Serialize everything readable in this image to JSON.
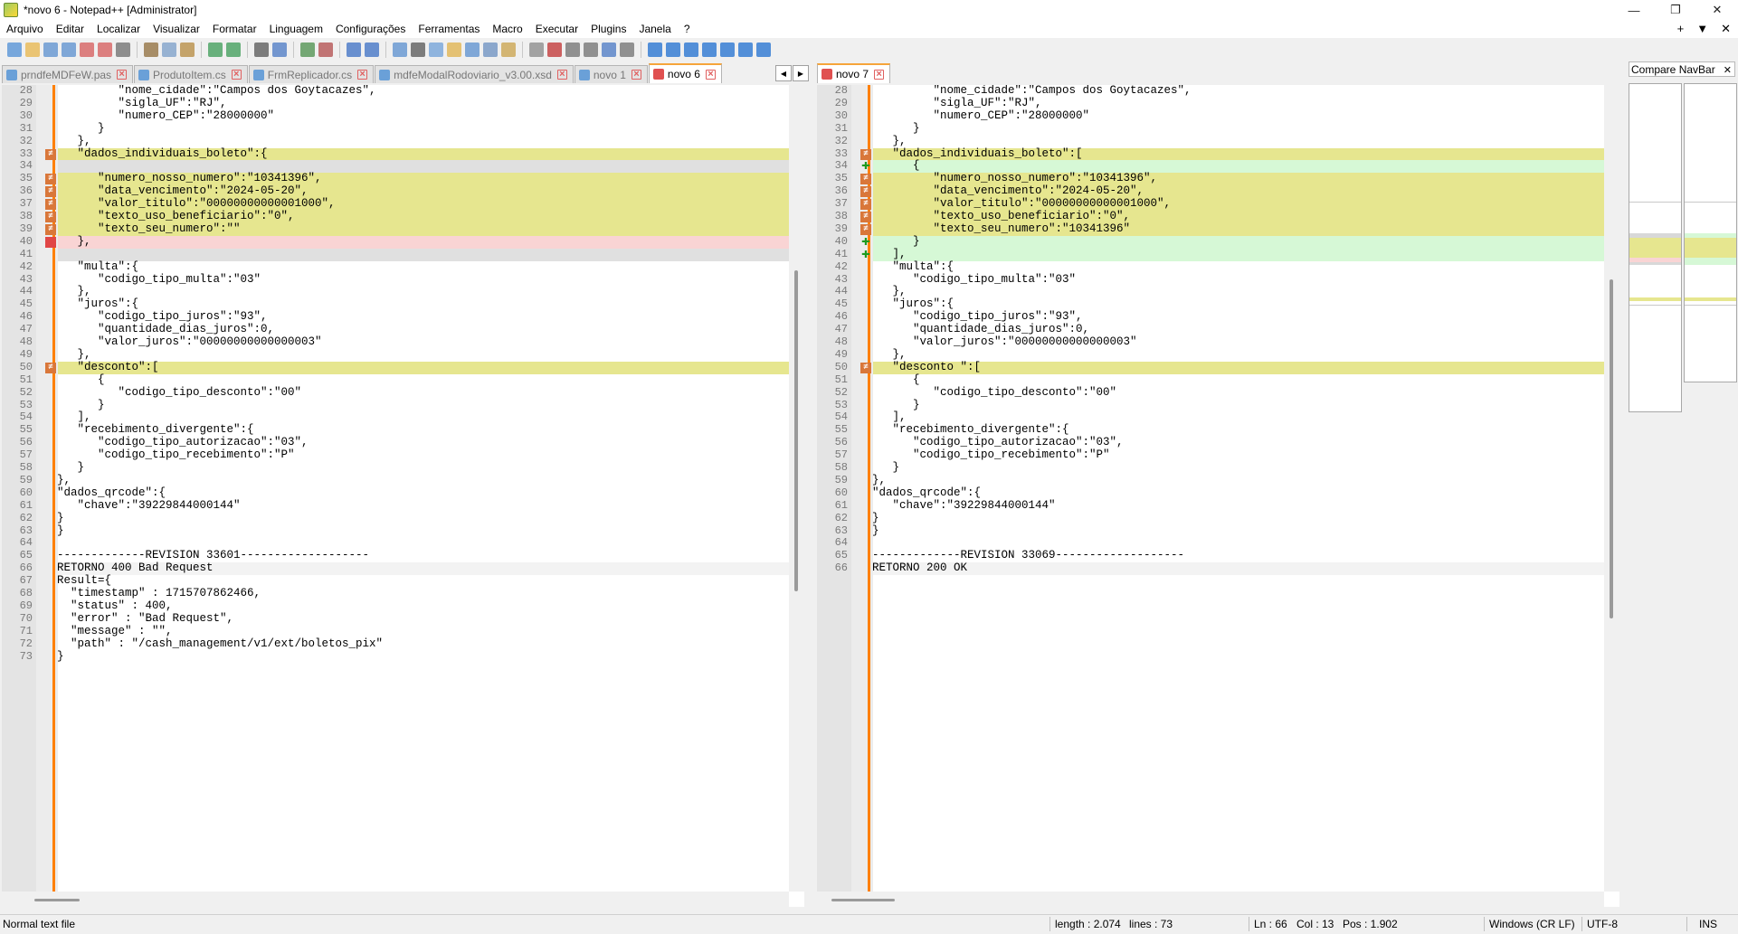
{
  "window": {
    "title": "*novo 6 - Notepad++ [Administrator]",
    "controls": [
      "—",
      "❐",
      "✕"
    ]
  },
  "menu": {
    "items": [
      "Arquivo",
      "Editar",
      "Localizar",
      "Visualizar",
      "Formatar",
      "Linguagem",
      "Configurações",
      "Ferramentas",
      "Macro",
      "Executar",
      "Plugins",
      "Janela",
      "?"
    ],
    "right": [
      "+",
      "▼",
      "✕"
    ]
  },
  "toolbar": {
    "icons": [
      "new-file-icon",
      "open-icon",
      "save-icon",
      "save-all-icon",
      "close-icon",
      "close-all-icon",
      "print-icon",
      "cut-icon",
      "copy-icon",
      "paste-icon",
      "undo-icon",
      "redo-icon",
      "find-icon",
      "replace-icon",
      "zoom-in-icon",
      "zoom-out-icon",
      "sync-vertical-icon",
      "sync-horizontal-icon",
      "word-wrap-icon",
      "show-all-chars-icon",
      "indent-guide-icon",
      "udl-icon",
      "doc-map-icon",
      "function-list-icon",
      "folder-workspace-icon",
      "monitoring-icon",
      "record-macro-icon",
      "stop-macro-icon",
      "play-macro-icon",
      "run-macro-multiple-icon",
      "save-macro-icon",
      "compare-icon",
      "compare-clear-icon",
      "compare-first-icon",
      "compare-prev-icon",
      "compare-next-icon",
      "compare-last-icon",
      "compare-navbar-icon"
    ]
  },
  "tabs_left": [
    {
      "label": "prndfeMDFeW.pas",
      "color": "#6aa0d8",
      "active": false
    },
    {
      "label": "ProdutoItem.cs",
      "color": "#6aa0d8",
      "active": false
    },
    {
      "label": "FrmReplicador.cs",
      "color": "#6aa0d8",
      "active": false
    },
    {
      "label": "mdfeModalRodoviario_v3.00.xsd",
      "color": "#6aa0d8",
      "active": false
    },
    {
      "label": "novo 1",
      "color": "#6aa0d8",
      "active": false
    },
    {
      "label": "novo 6",
      "color": "#e05050",
      "active": true
    }
  ],
  "tabs_right": [
    {
      "label": "novo 7",
      "color": "#e05050",
      "active": true
    }
  ],
  "tab_nav": [
    "◀",
    "▶"
  ],
  "left_lines": [
    {
      "n": "28",
      "t": "         \"nome_cidade\":\"Campos dos Goytacazes\",",
      "bg": "",
      "mark": ""
    },
    {
      "n": "29",
      "t": "         \"sigla_UF\":\"RJ\",",
      "bg": "",
      "mark": ""
    },
    {
      "n": "30",
      "t": "         \"numero_CEP\":\"28000000\"",
      "bg": "",
      "mark": ""
    },
    {
      "n": "31",
      "t": "      }",
      "bg": "",
      "mark": ""
    },
    {
      "n": "32",
      "t": "   },",
      "bg": "",
      "mark": ""
    },
    {
      "n": "33",
      "t": "   \"dados_individuais_boleto\":{",
      "bg": "#e6e68f",
      "mark": "changed"
    },
    {
      "n": "34",
      "t": "",
      "bg": "#e0e0e0",
      "mark": ""
    },
    {
      "n": "35",
      "t": "      \"numero_nosso_numero\":\"10341396\",",
      "bg": "#e6e68f",
      "mark": "changed"
    },
    {
      "n": "36",
      "t": "      \"data_vencimento\":\"2024-05-20\",",
      "bg": "#e6e68f",
      "mark": "changed"
    },
    {
      "n": "37",
      "t": "      \"valor_titulo\":\"00000000000001000\",",
      "bg": "#e6e68f",
      "mark": "changed"
    },
    {
      "n": "38",
      "t": "      \"texto_uso_beneficiario\":\"0\",",
      "bg": "#e6e68f",
      "mark": "changed"
    },
    {
      "n": "39",
      "t": "      \"texto_seu_numero\":\"\"",
      "bg": "#e6e68f",
      "mark": "changed"
    },
    {
      "n": "40",
      "t": "   },",
      "bg": "#f9d4d4",
      "mark": "removed"
    },
    {
      "n": "41",
      "t": "",
      "bg": "#e0e0e0",
      "mark": ""
    },
    {
      "n": "42",
      "t": "   \"multa\":{",
      "bg": "",
      "mark": ""
    },
    {
      "n": "43",
      "t": "      \"codigo_tipo_multa\":\"03\"",
      "bg": "",
      "mark": ""
    },
    {
      "n": "44",
      "t": "   },",
      "bg": "",
      "mark": ""
    },
    {
      "n": "45",
      "t": "   \"juros\":{",
      "bg": "",
      "mark": ""
    },
    {
      "n": "46",
      "t": "      \"codigo_tipo_juros\":\"93\",",
      "bg": "",
      "mark": ""
    },
    {
      "n": "47",
      "t": "      \"quantidade_dias_juros\":0,",
      "bg": "",
      "mark": ""
    },
    {
      "n": "48",
      "t": "      \"valor_juros\":\"00000000000000003\"",
      "bg": "",
      "mark": ""
    },
    {
      "n": "49",
      "t": "   },",
      "bg": "",
      "mark": ""
    },
    {
      "n": "50",
      "t": "   \"desconto\":[",
      "bg": "#e6e68f",
      "mark": "changed"
    },
    {
      "n": "51",
      "t": "      {",
      "bg": "",
      "mark": ""
    },
    {
      "n": "52",
      "t": "         \"codigo_tipo_desconto\":\"00\"",
      "bg": "",
      "mark": ""
    },
    {
      "n": "53",
      "t": "      }",
      "bg": "",
      "mark": ""
    },
    {
      "n": "54",
      "t": "   ],",
      "bg": "",
      "mark": ""
    },
    {
      "n": "55",
      "t": "   \"recebimento_divergente\":{",
      "bg": "",
      "mark": ""
    },
    {
      "n": "56",
      "t": "      \"codigo_tipo_autorizacao\":\"03\",",
      "bg": "",
      "mark": ""
    },
    {
      "n": "57",
      "t": "      \"codigo_tipo_recebimento\":\"P\"",
      "bg": "",
      "mark": ""
    },
    {
      "n": "58",
      "t": "   }",
      "bg": "",
      "mark": ""
    },
    {
      "n": "59",
      "t": "},",
      "bg": "",
      "mark": ""
    },
    {
      "n": "60",
      "t": "\"dados_qrcode\":{",
      "bg": "",
      "mark": ""
    },
    {
      "n": "61",
      "t": "   \"chave\":\"39229844000144\"",
      "bg": "",
      "mark": ""
    },
    {
      "n": "62",
      "t": "}",
      "bg": "",
      "mark": ""
    },
    {
      "n": "63",
      "t": "}",
      "bg": "",
      "mark": ""
    },
    {
      "n": "64",
      "t": "",
      "bg": "",
      "mark": ""
    },
    {
      "n": "65",
      "t": "-------------REVISION 33601-------------------",
      "bg": "",
      "mark": ""
    },
    {
      "n": "66",
      "t": "RETORNO 400 Bad Request",
      "bg": "#f3f3f3",
      "mark": ""
    },
    {
      "n": "67",
      "t": "Result={",
      "bg": "",
      "mark": ""
    },
    {
      "n": "68",
      "t": "  \"timestamp\" : 1715707862466,",
      "bg": "",
      "mark": ""
    },
    {
      "n": "69",
      "t": "  \"status\" : 400,",
      "bg": "",
      "mark": ""
    },
    {
      "n": "70",
      "t": "  \"error\" : \"Bad Request\",",
      "bg": "",
      "mark": ""
    },
    {
      "n": "71",
      "t": "  \"message\" : \"\",",
      "bg": "",
      "mark": ""
    },
    {
      "n": "72",
      "t": "  \"path\" : \"/cash_management/v1/ext/boletos_pix\"",
      "bg": "",
      "mark": ""
    },
    {
      "n": "73",
      "t": "}",
      "bg": "",
      "mark": ""
    }
  ],
  "right_lines": [
    {
      "n": "28",
      "t": "         \"nome_cidade\":\"Campos dos Goytacazes\",",
      "bg": "",
      "mark": ""
    },
    {
      "n": "29",
      "t": "         \"sigla_UF\":\"RJ\",",
      "bg": "",
      "mark": ""
    },
    {
      "n": "30",
      "t": "         \"numero_CEP\":\"28000000\"",
      "bg": "",
      "mark": ""
    },
    {
      "n": "31",
      "t": "      }",
      "bg": "",
      "mark": ""
    },
    {
      "n": "32",
      "t": "   },",
      "bg": "",
      "mark": ""
    },
    {
      "n": "33",
      "t": "   \"dados_individuais_boleto\":[",
      "bg": "#e6e68f",
      "mark": "changed"
    },
    {
      "n": "34",
      "t": "      {",
      "bg": "#d6f8d6",
      "mark": "added"
    },
    {
      "n": "35",
      "t": "         \"numero_nosso_numero\":\"10341396\",",
      "bg": "#e6e68f",
      "mark": "changed"
    },
    {
      "n": "36",
      "t": "         \"data_vencimento\":\"2024-05-20\",",
      "bg": "#e6e68f",
      "mark": "changed"
    },
    {
      "n": "37",
      "t": "         \"valor_titulo\":\"00000000000001000\",",
      "bg": "#e6e68f",
      "mark": "changed"
    },
    {
      "n": "38",
      "t": "         \"texto_uso_beneficiario\":\"0\",",
      "bg": "#e6e68f",
      "mark": "changed"
    },
    {
      "n": "39",
      "t": "         \"texto_seu_numero\":\"10341396\"",
      "bg": "#e6e68f",
      "mark": "changed"
    },
    {
      "n": "40",
      "t": "      }",
      "bg": "#d6f8d6",
      "mark": "added"
    },
    {
      "n": "41",
      "t": "   ],",
      "bg": "#d6f8d6",
      "mark": "added"
    },
    {
      "n": "42",
      "t": "   \"multa\":{",
      "bg": "",
      "mark": ""
    },
    {
      "n": "43",
      "t": "      \"codigo_tipo_multa\":\"03\"",
      "bg": "",
      "mark": ""
    },
    {
      "n": "44",
      "t": "   },",
      "bg": "",
      "mark": ""
    },
    {
      "n": "45",
      "t": "   \"juros\":{",
      "bg": "",
      "mark": ""
    },
    {
      "n": "46",
      "t": "      \"codigo_tipo_juros\":\"93\",",
      "bg": "",
      "mark": ""
    },
    {
      "n": "47",
      "t": "      \"quantidade_dias_juros\":0,",
      "bg": "",
      "mark": ""
    },
    {
      "n": "48",
      "t": "      \"valor_juros\":\"00000000000000003\"",
      "bg": "",
      "mark": ""
    },
    {
      "n": "49",
      "t": "   },",
      "bg": "",
      "mark": ""
    },
    {
      "n": "50",
      "t": "   \"desconto \":[",
      "bg": "#e6e68f",
      "mark": "changed"
    },
    {
      "n": "51",
      "t": "      {",
      "bg": "",
      "mark": ""
    },
    {
      "n": "52",
      "t": "         \"codigo_tipo_desconto\":\"00\"",
      "bg": "",
      "mark": ""
    },
    {
      "n": "53",
      "t": "      }",
      "bg": "",
      "mark": ""
    },
    {
      "n": "54",
      "t": "   ],",
      "bg": "",
      "mark": ""
    },
    {
      "n": "55",
      "t": "   \"recebimento_divergente\":{",
      "bg": "",
      "mark": ""
    },
    {
      "n": "56",
      "t": "      \"codigo_tipo_autorizacao\":\"03\",",
      "bg": "",
      "mark": ""
    },
    {
      "n": "57",
      "t": "      \"codigo_tipo_recebimento\":\"P\"",
      "bg": "",
      "mark": ""
    },
    {
      "n": "58",
      "t": "   }",
      "bg": "",
      "mark": ""
    },
    {
      "n": "59",
      "t": "},",
      "bg": "",
      "mark": ""
    },
    {
      "n": "60",
      "t": "\"dados_qrcode\":{",
      "bg": "",
      "mark": ""
    },
    {
      "n": "61",
      "t": "   \"chave\":\"39229844000144\"",
      "bg": "",
      "mark": ""
    },
    {
      "n": "62",
      "t": "}",
      "bg": "",
      "mark": ""
    },
    {
      "n": "63",
      "t": "}",
      "bg": "",
      "mark": ""
    },
    {
      "n": "64",
      "t": "",
      "bg": "",
      "mark": ""
    },
    {
      "n": "65",
      "t": "-------------REVISION 33069-------------------",
      "bg": "",
      "mark": ""
    },
    {
      "n": "66",
      "t": "RETORNO 200 OK",
      "bg": "#f3f3f3",
      "mark": ""
    }
  ],
  "compare_navbar": {
    "title": "Compare NavBar",
    "close": "✕"
  },
  "status": {
    "file_type": "Normal text file",
    "length": "length : 2.074",
    "lines": "lines : 73",
    "ln": "Ln : 66",
    "col": "Col : 13",
    "pos": "Pos : 1.902",
    "eol": "Windows (CR LF)",
    "encoding": "UTF-8",
    "mode": "INS"
  },
  "colors": {
    "changed_line": "#e6e68f",
    "added_line": "#d6f8d6",
    "removed_line": "#f9d4d4",
    "moved_empty": "#e0e0e0",
    "fold_margin": "#ff8000",
    "active_tab_accent": "#f6a53b"
  }
}
